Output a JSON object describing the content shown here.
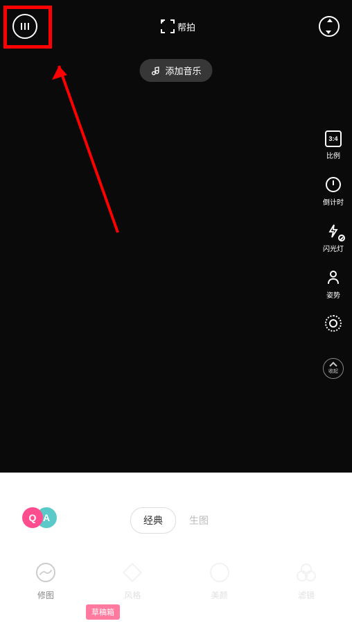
{
  "topbar": {
    "help_capture_label": "帮拍"
  },
  "add_music_label": "添加音乐",
  "side_tools": {
    "ratio": {
      "icon_text": "3:4",
      "label": "比例"
    },
    "timer": {
      "label": "倒计时"
    },
    "flash": {
      "label": "闪光灯"
    },
    "pose": {
      "label": "姿势"
    },
    "beauty": {
      "label": ""
    },
    "collapse": {
      "label": "收起"
    }
  },
  "mode_tabs": {
    "classic": "经典",
    "raw": "生图"
  },
  "bottom_tools": {
    "retouch": "修图",
    "style": "风格",
    "beauty": "美颜",
    "filter": "滤镜"
  },
  "watermark": "草稿箱",
  "colors": {
    "highlight": "#ff0000",
    "watermark_bg": "#ff7a9e"
  }
}
